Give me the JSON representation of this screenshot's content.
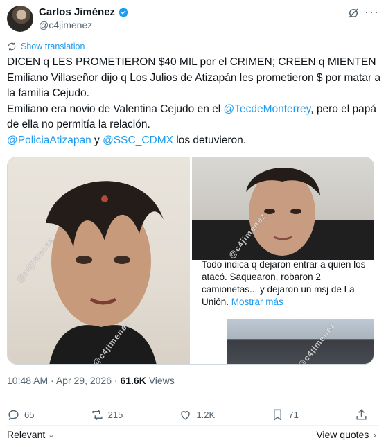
{
  "author": {
    "display_name": "Carlos Jiménez",
    "handle": "@c4jimenez",
    "verified": true
  },
  "translate": {
    "label": "Show translation"
  },
  "tweet": {
    "line1": "DICEN q LES PROMETIERON $40 MIL por el CRIMEN; CREEN q MIENTEN",
    "line2": "Emiliano Villaseñor dijo q Los Julios de Atizapán les prometieron $ por matar a la familia Cejudo.",
    "line3_pre": "Emiliano era novio de Valentina Cejudo en el ",
    "line3_mention": "@TecdeMonterrey",
    "line3_post": ", pero el papá de ella no permitía la relación.",
    "line4_mention1": "@PoliciaAtizapan",
    "line4_mid": " y ",
    "line4_mention2": "@SSC_CDMX",
    "line4_post": " los detuvieron."
  },
  "media": {
    "watermark": "@c4jimenez",
    "embedded_text": "Todo indica q dejaron entrar a quien los atacó. Saquearon, robaron 2 camionetas... y dejaron un msj de La Unión.",
    "embedded_show_more": "Mostrar más"
  },
  "meta": {
    "time": "10:48 AM",
    "separator": " · ",
    "date": "Apr 29, 2026",
    "views_count": "61.6K",
    "views_label": " Views"
  },
  "actions": {
    "replies": "65",
    "reposts": "215",
    "likes": "1.2K",
    "bookmarks": "71"
  },
  "footer": {
    "sort_label": "Relevant",
    "view_quotes": "View quotes"
  },
  "colors": {
    "accent": "#1d9bf0",
    "text": "#0f1419",
    "muted": "#536471"
  },
  "icons": [
    "verified-badge-icon",
    "grok-icon",
    "more-icon",
    "translate-icon",
    "reply-icon",
    "repost-icon",
    "like-icon",
    "bookmark-icon",
    "share-icon",
    "chevron-down-icon",
    "chevron-right-icon"
  ]
}
